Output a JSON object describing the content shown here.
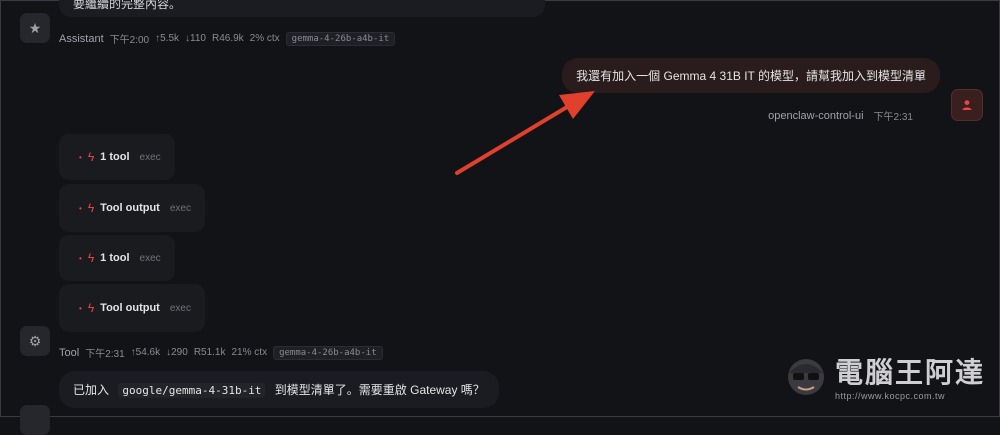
{
  "top": {
    "partial_text": "要繼續的完整內容。"
  },
  "assistant_meta": {
    "role": "Assistant",
    "time": "下午2:00",
    "up": "↑5.5k",
    "down": "↓110",
    "r": "R46.9k",
    "ctx": "2% ctx",
    "model": "gemma-4-26b-a4b-it"
  },
  "user_message": {
    "text": "我還有加入一個 Gemma 4 31B IT 的模型，請幫我加入到模型清單",
    "sender": "openclaw-control-ui",
    "time": "下午2:31"
  },
  "tool_cards": [
    {
      "name": "1 tool",
      "sub": "exec"
    },
    {
      "name": "Tool output",
      "sub": "exec"
    },
    {
      "name": "1 tool",
      "sub": "exec"
    },
    {
      "name": "Tool output",
      "sub": "exec"
    }
  ],
  "tool_meta": {
    "role": "Tool",
    "time": "下午2:31",
    "up": "↑54.6k",
    "down": "↓290",
    "r": "R51.1k",
    "ctx": "21% ctx",
    "model": "gemma-4-26b-a4b-it"
  },
  "tool_reply": {
    "prefix": "已加入",
    "code": "google/gemma-4-31b-it",
    "suffix": "到模型清單了。需要重啟 Gateway 嗎？"
  },
  "icons": {
    "assistant_avatar": "star-icon",
    "tool_avatar": "gear-icon",
    "user_avatar": "user-icon",
    "tool_item": "bolt-icon"
  },
  "colors": {
    "accent": "#ef4444",
    "background": "#121317",
    "arrow": "#e0402c"
  },
  "watermark": {
    "title": "電腦王阿達",
    "url": "http://www.kocpc.com.tw"
  }
}
